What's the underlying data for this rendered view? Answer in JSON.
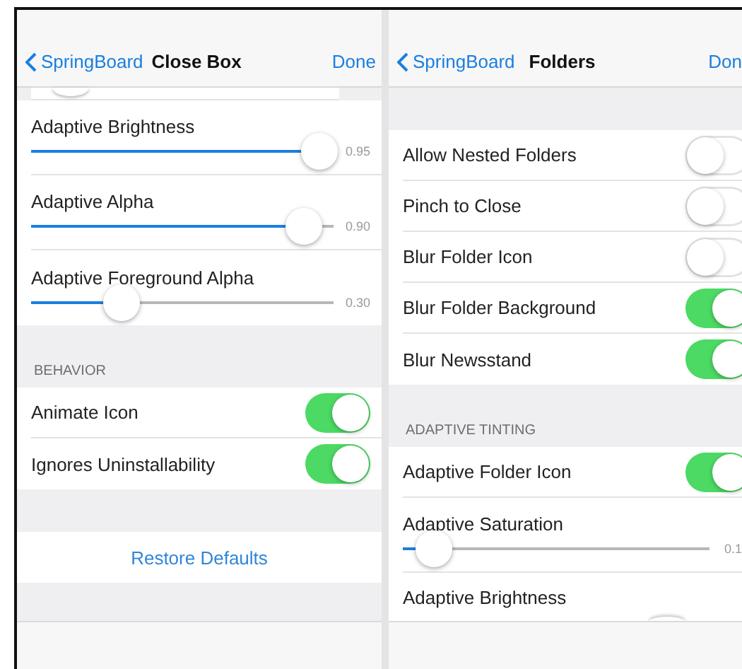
{
  "panels": [
    {
      "nav": {
        "back": "SpringBoard",
        "title": "Close Box",
        "done": "Done"
      },
      "peek": {
        "level": 0.13
      },
      "sections": [
        {
          "rows": [
            {
              "kind": "slider",
              "label": "Adaptive Brightness",
              "level": 0.95,
              "reading": "0.95"
            },
            {
              "kind": "slider",
              "label": "Adaptive Alpha",
              "level": 0.9,
              "reading": "0.90"
            },
            {
              "kind": "slider",
              "label": "Adaptive Foreground Alpha",
              "level": 0.3,
              "reading": "0.30"
            }
          ]
        },
        {
          "header": "BEHAVIOR",
          "rows": [
            {
              "kind": "toggle",
              "label": "Animate Icon",
              "on": true
            },
            {
              "kind": "toggle",
              "label": "Ignores Uninstallability",
              "on": true
            }
          ]
        },
        {
          "rows": [
            {
              "kind": "button",
              "label": "Restore Defaults"
            }
          ]
        }
      ]
    },
    {
      "nav": {
        "back": "SpringBoard",
        "title": "Folders",
        "done": "Don"
      },
      "sections": [
        {
          "rows": [
            {
              "kind": "toggle",
              "label": "Allow Nested Folders",
              "on": false
            },
            {
              "kind": "toggle",
              "label": "Pinch to Close",
              "on": false
            },
            {
              "kind": "toggle",
              "label": "Blur Folder Icon",
              "on": false
            },
            {
              "kind": "toggle",
              "label": "Blur Folder Background",
              "on": true
            },
            {
              "kind": "toggle",
              "label": "Blur Newsstand",
              "on": true
            }
          ]
        },
        {
          "header": "ADAPTIVE TINTING",
          "rows": [
            {
              "kind": "toggle",
              "label": "Adaptive Folder Icon",
              "on": true
            },
            {
              "kind": "slider",
              "label": "Adaptive Saturation",
              "level": 0.1,
              "reading": "0.1"
            },
            {
              "kind": "slider_hidden",
              "label": "Adaptive Brightness",
              "level": 0.86
            }
          ]
        }
      ]
    }
  ]
}
